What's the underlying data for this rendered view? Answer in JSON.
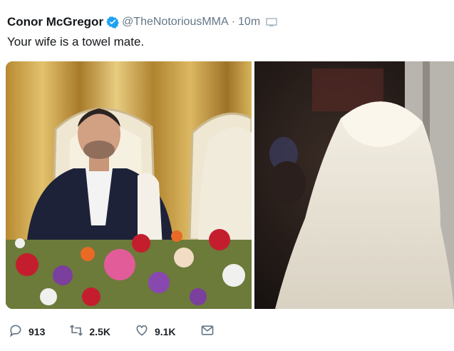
{
  "tweet": {
    "author_name": "Conor McGregor",
    "handle": "@TheNotoriousMMA",
    "separator": "·",
    "timestamp": "10m",
    "text": "Your wife is a towel mate.",
    "verified_icon": "verified-badge-icon",
    "accent_color": "#1da1f2"
  },
  "actions": {
    "reply_count": "913",
    "retweet_count": "2.5K",
    "like_count": "9.1K",
    "icons": [
      "reply-icon",
      "retweet-icon",
      "like-icon",
      "dm-icon"
    ]
  }
}
